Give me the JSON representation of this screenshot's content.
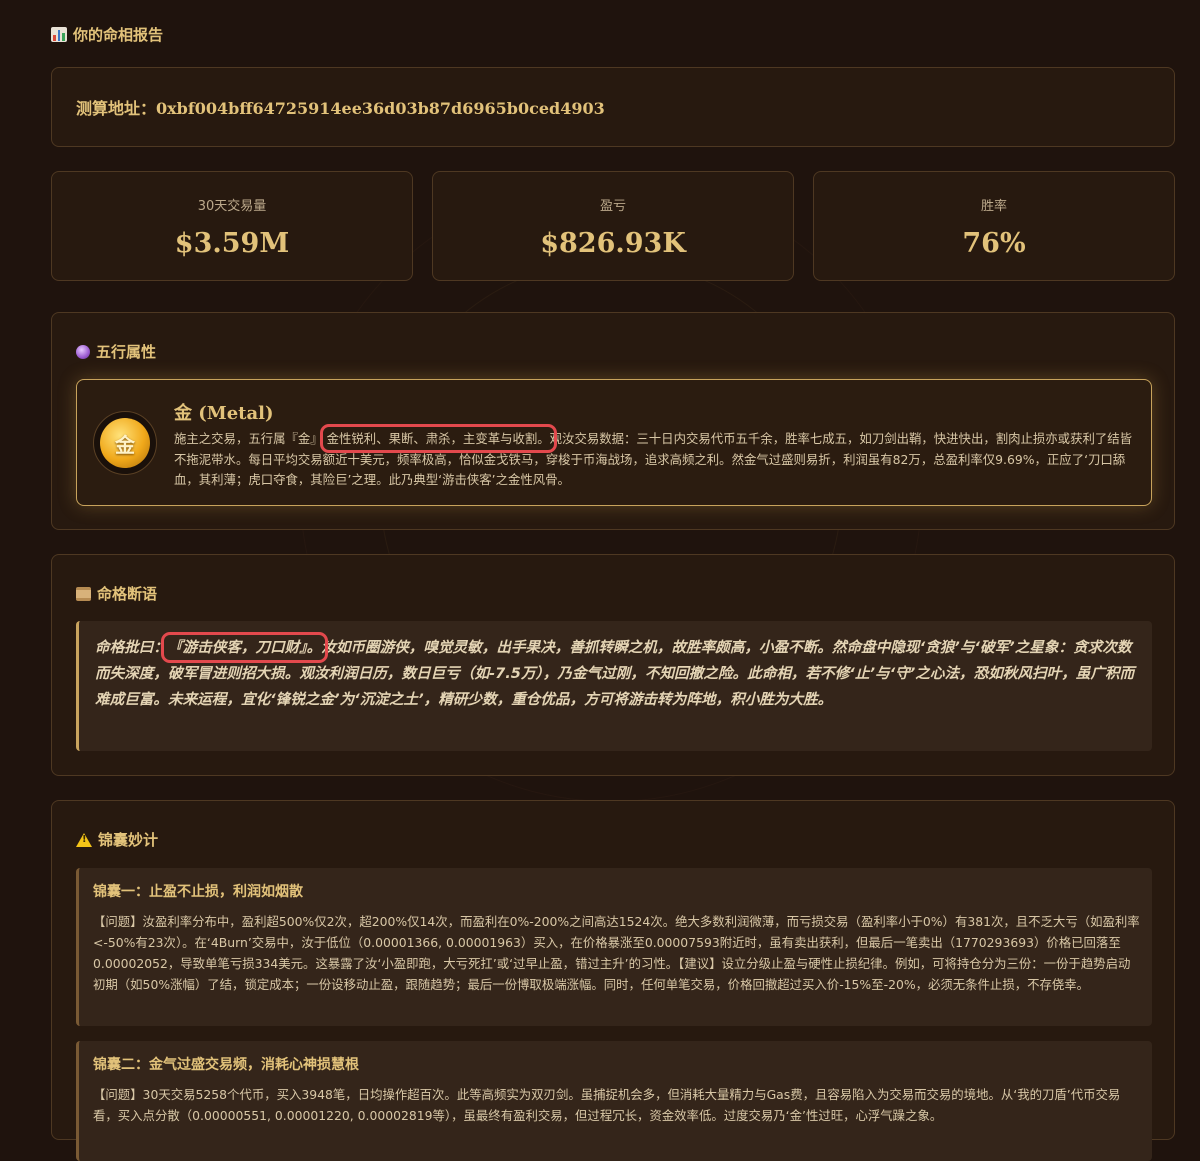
{
  "page": {
    "title": "你的命相报告"
  },
  "address": {
    "label": "测算地址：0xbf004bff64725914ee36d03b87d6965b0ced4903"
  },
  "stats": [
    {
      "label": "30天交易量",
      "value": "$3.59M"
    },
    {
      "label": "盈亏",
      "value": "$826.93K"
    },
    {
      "label": "胜率",
      "value": "76%"
    }
  ],
  "wuxing": {
    "title": "五行属性",
    "coin_char": "金",
    "name": "金 (Metal)",
    "desc_before": "施主之交易，五行属『金』",
    "desc_highlight": "金性锐利、果断、肃杀，主变革与收割。",
    "desc_after": "观汝交易数据：三十日内交易代币五千余，胜率七成五，如刀剑出鞘，快进快出，割肉止损亦或获利了结皆不拖泥带水。每日平均交易额近十美元，频率极高，恰似金戈铁马，穿梭于币海战场，追求高频之利。然金气过盛则易折，利润虽有82万，总盈利率仅9.69%，正应了‘刀口舔血，其利薄；虎口夺食，其险巨’之理。此乃典型‘游击侠客’之金性风骨。"
  },
  "mingge": {
    "title": "命格断语",
    "prefix": "命格批曰：",
    "highlight": "『游击侠客，刀口财』。",
    "text": "汝如币圈游侠，嗅觉灵敏，出手果决，善抓转瞬之机，故胜率颇高，小盈不断。然命盘中隐现‘贪狼’与‘破军’之星象：贪求次数而失深度，破军冒进则招大损。观汝利润日历，数日巨亏（如-7.5万），乃金气过刚，不知回撤之险。此命相，若不修‘止’与‘守’之心法，恐如秋风扫叶，虽广积而难成巨富。未来运程，宜化‘锋锐之金’为‘沉淀之土’，精研少数，重仓优品，方可将游击转为阵地，积小胜为大胜。"
  },
  "tips": {
    "title": "锦囊妙计",
    "items": [
      {
        "title": "锦囊一：止盈不止损，利润如烟散",
        "text": "【问题】汝盈利率分布中，盈利超500%仅2次，超200%仅14次，而盈利在0%-200%之间高达1524次。绝大多数利润微薄，而亏损交易（盈利率小于0%）有381次，且不乏大亏（如盈利率<-50%有23次）。在‘4Burn’交易中，汝于低位（0.00001366, 0.00001963）买入，在价格暴涨至0.00007593附近时，虽有卖出获利，但最后一笔卖出（1770293693）价格已回落至0.00002052，导致单笔亏损334美元。这暴露了汝‘小盈即跑，大亏死扛’或‘过早止盈，错过主升’的习性。【建议】设立分级止盈与硬性止损纪律。例如，可将持仓分为三份：一份于趋势启动初期（如50%涨幅）了结，锁定成本；一份设移动止盈，跟随趋势；最后一份博取极端涨幅。同时，任何单笔交易，价格回撤超过买入价-15%至-20%，必须无条件止损，不存侥幸。"
      },
      {
        "title": "锦囊二：金气过盛交易频，消耗心神损慧根",
        "text": "【问题】30天交易5258个代币，买入3948笔，日均操作超百次。此等高频实为双刃剑。虽捕捉机会多，但消耗大量精力与Gas费，且容易陷入为交易而交易的境地。从‘我的刀盾’代币交易看，买入点分散（0.00000551, 0.00001220, 0.00002819等），虽最终有盈利交易，但过程冗长，资金效率低。过度交易乃‘金’性过旺，心浮气躁之象。"
      }
    ]
  }
}
